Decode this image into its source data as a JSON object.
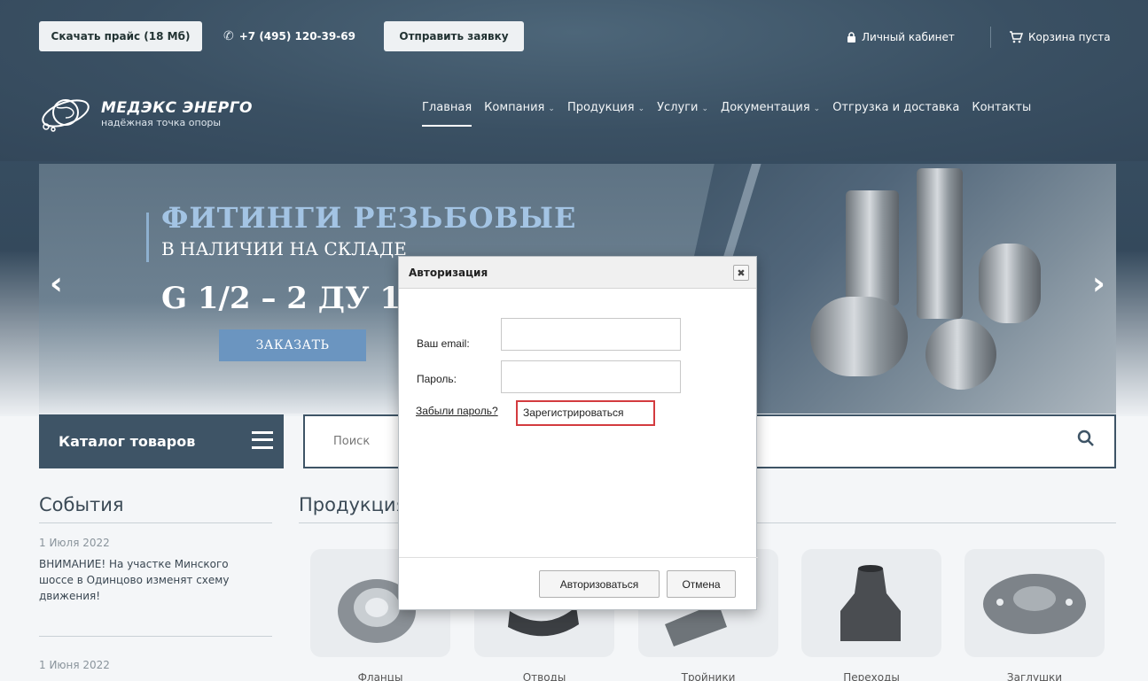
{
  "topbar": {
    "price_button": "Скачать прайс (18 Мб)",
    "phone": "+7 (495) 120-39-69",
    "request_button": "Отправить заявку",
    "account": "Личный кабинет",
    "cart": "Корзина пуста"
  },
  "logo": {
    "title": "МЕДЭКС ЭНЕРГО",
    "subtitle": "надёжная точка опоры"
  },
  "nav": [
    {
      "label": "Главная",
      "dropdown": false
    },
    {
      "label": "Компания",
      "dropdown": true
    },
    {
      "label": "Продукция",
      "dropdown": true
    },
    {
      "label": "Услуги",
      "dropdown": true
    },
    {
      "label": "Документация",
      "dropdown": true
    },
    {
      "label": "Отгрузка и доставка",
      "dropdown": false
    },
    {
      "label": "Контакты",
      "dropdown": false
    }
  ],
  "banner": {
    "title": "ФИТИНГИ РЕЗЬБОВЫЕ",
    "subtitle": "В НАЛИЧИИ НА СКЛАДЕ",
    "spec": "G 1/2 – 2 ДУ 15-50",
    "order_button": "ЗАКАЗАТЬ"
  },
  "catalog": {
    "label": "Каталог товаров"
  },
  "search": {
    "placeholder": "Поиск"
  },
  "events": {
    "title": "События",
    "items": [
      {
        "date": "1 Июля 2022",
        "text": "ВНИМАНИЕ! На участке Минского шоссе в Одинцово изменят схему движения!"
      },
      {
        "date": "1 Июня 2022",
        "text": ""
      }
    ]
  },
  "products": {
    "title": "Продукция",
    "items": [
      "Фланцы",
      "Отводы",
      "Тройники",
      "Переходы",
      "Заглушки"
    ]
  },
  "modal": {
    "title": "Авторизация",
    "close": "✖",
    "email_label": "Ваш email:",
    "password_label": "Пароль:",
    "forgot_link": "Забыли пароль?",
    "register_link": "Зарегистрироваться",
    "login_button": "Авторизоваться",
    "cancel_button": "Отмена"
  },
  "colors": {
    "accent": "#3e5466",
    "highlight": "#d33b3f",
    "banner_button": "#6b95c0"
  }
}
